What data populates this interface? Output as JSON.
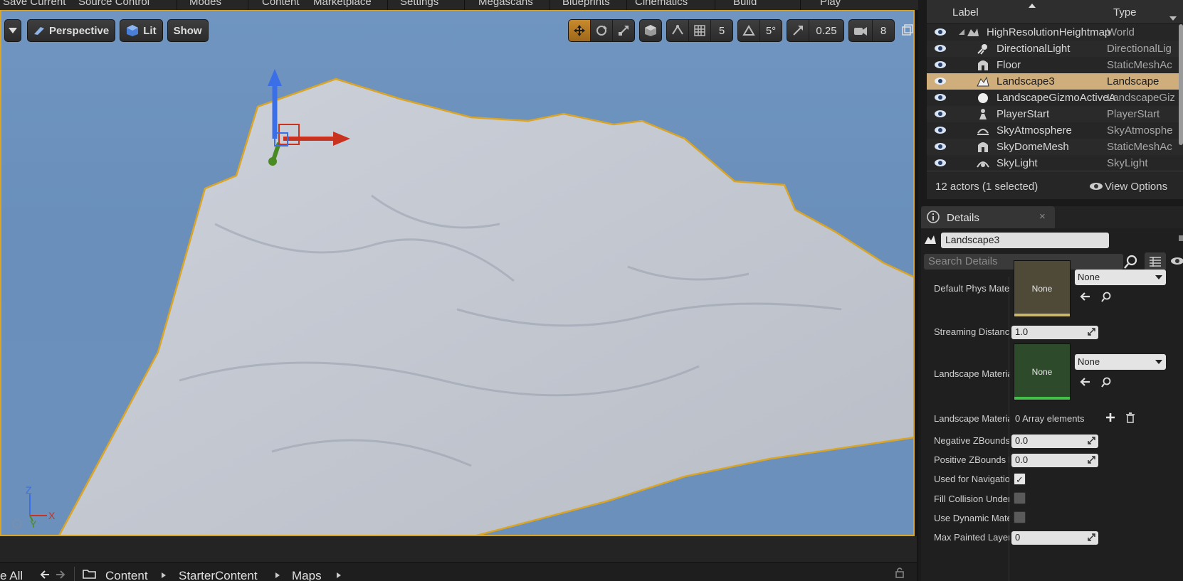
{
  "toolbar": {
    "items": [
      "Save Current",
      "Source Control",
      "Modes",
      "Content",
      "Marketplace",
      "Settings",
      "Megascans",
      "Blueprints",
      "Cinematics",
      "Build",
      "Play"
    ]
  },
  "viewport": {
    "perspective_label": "Perspective",
    "lit_label": "Lit",
    "show_label": "Show",
    "grid_snap": "5",
    "rotate_snap": "5°",
    "scale_snap": "0.25",
    "camera_speed": "8",
    "axis_z": "Z",
    "axis_x": "X",
    "axis_y": "Y"
  },
  "content_browser": {
    "select_all": "e All",
    "crumbs": [
      "Content",
      "StarterContent",
      "Maps"
    ]
  },
  "outliner": {
    "col_label": "Label",
    "col_type": "Type",
    "rows": [
      {
        "label": "HighResolutionHeightmap",
        "type": "World",
        "icon": "world-icon"
      },
      {
        "label": "DirectionalLight",
        "type": "DirectionalLig",
        "icon": "sun-icon"
      },
      {
        "label": "Floor",
        "type": "StaticMeshAc",
        "icon": "static-mesh-icon"
      },
      {
        "label": "Landscape3",
        "type": "Landscape",
        "icon": "landscape-icon"
      },
      {
        "label": "LandscapeGizmoActiveA",
        "type": "LandscapeGiz",
        "icon": "sphere-icon"
      },
      {
        "label": "PlayerStart",
        "type": "PlayerStart",
        "icon": "player-start-icon"
      },
      {
        "label": "SkyAtmosphere",
        "type": "SkyAtmosphe",
        "icon": "sky-atmosphere-icon"
      },
      {
        "label": "SkyDomeMesh",
        "type": "StaticMeshAc",
        "icon": "static-mesh-icon"
      },
      {
        "label": "SkyLight",
        "type": "SkyLight",
        "icon": "skylight-icon"
      }
    ],
    "selected_row": "Landscape3",
    "actor_count": "12 actors (1 selected)",
    "view_options": "View Options"
  },
  "details": {
    "tab_label": "Details",
    "tab_close": "×",
    "object_name": "Landscape3",
    "search_placeholder": "Search Details",
    "default_phys_label": "Default Phys Mater",
    "default_phys_thumb": "None",
    "default_phys_combo": "None",
    "streaming_label": "Streaming Distance",
    "streaming_value": "1.0",
    "landscape_mat_label": "Landscape Materia",
    "landscape_mat_thumb": "None",
    "landscape_mat_combo": "None",
    "landscape_mat2_label": "Landscape Materia",
    "array_text": "0 Array elements",
    "neg_z_label": "Negative ZBounds",
    "neg_z_value": "0.0",
    "pos_z_label": "Positive ZBounds E",
    "pos_z_value": "0.0",
    "nav_label": "Used for Navigatio",
    "nav_checked": true,
    "fill_label": "Fill Collision Under",
    "fill_checked": false,
    "dyn_label": "Use Dynamic Mate",
    "dyn_checked": false,
    "max_painted_label": "Max Painted Layer",
    "max_painted_value": "0"
  },
  "colors": {
    "selection_outline": "#d9a528",
    "sky": "#6b90bb",
    "terrain": "#c9cdd6",
    "selected_row": "#cfae7c",
    "phys_thumb": "#4f4a37",
    "material_thumb": "#2d4a2a"
  }
}
